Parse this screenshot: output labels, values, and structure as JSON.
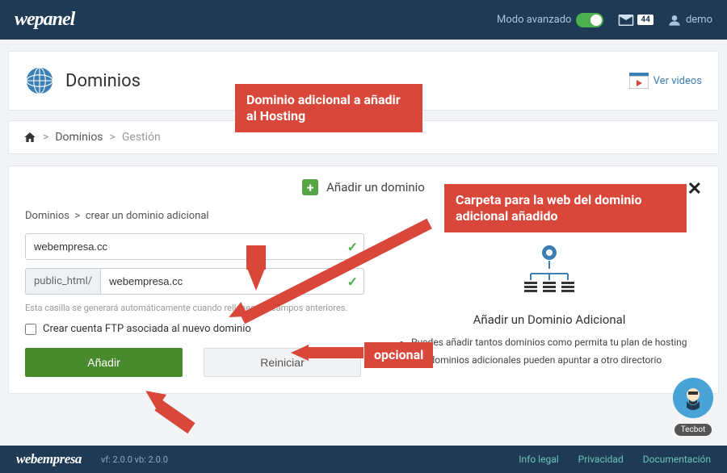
{
  "topbar": {
    "logo": "wepanel",
    "advanced_mode": "Modo avanzado",
    "mail_count": "44",
    "user": "demo"
  },
  "page_header": {
    "title": "Dominios",
    "videos_link": "Ver videos"
  },
  "breadcrumb": {
    "l1": "Dominios",
    "l2": "Gestión"
  },
  "panel": {
    "head": "Añadir un dominio",
    "inner_crumb_l1": "Dominios",
    "inner_crumb_l2": "crear un dominio adicional",
    "domain_value": "webempresa.cc",
    "path_prefix": "public_html/",
    "path_value": "webempresa.cc",
    "help_text": "Esta casilla se generará automáticamente cuando rellenes los campos anteriores.",
    "ftp_checkbox_label": "Crear cuenta FTP asociada al nuevo dominio",
    "btn_add": "Añadir",
    "btn_reset": "Reiniciar",
    "info_title": "Añadir un Dominio Adicional",
    "info_bullets": [
      "Puedes añadir tantos dominios como permita tu plan de hosting",
      "Los dominios adicionales pueden apuntar a otro directorio"
    ]
  },
  "callouts": {
    "c1": "Dominio adicional a añadir al Hosting",
    "c2": "Carpeta para la web del dominio adicional añadido",
    "c3": "opcional"
  },
  "tecbot": "Tecbot",
  "footer": {
    "logo": "webempresa",
    "version": "vf: 2.0.0 vb: 2.0.0",
    "links": [
      "Info legal",
      "Privacidad",
      "Documentación"
    ]
  }
}
